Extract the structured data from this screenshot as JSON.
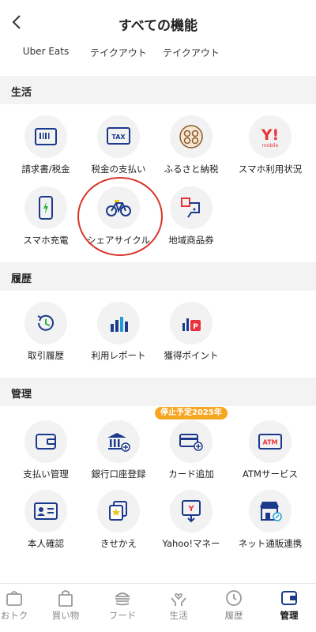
{
  "header": {
    "title": "すべての機能"
  },
  "top_row": [
    "Uber Eats",
    "テイクアウト",
    "テイクアウト"
  ],
  "sections": {
    "life": {
      "title": "生活",
      "items": [
        {
          "label": "請求書/税金",
          "icon": "barcode-icon"
        },
        {
          "label": "税金の支払い",
          "icon": "tax-icon"
        },
        {
          "label": "ふるさと納税",
          "icon": "furusato-icon"
        },
        {
          "label": "スマホ利用状況",
          "icon": "ymobile-icon"
        },
        {
          "label": "スマホ充電",
          "icon": "phone-charge-icon"
        },
        {
          "label": "シェアサイクル",
          "icon": "bicycle-icon"
        },
        {
          "label": "地域商品券",
          "icon": "local-voucher-icon"
        }
      ]
    },
    "history": {
      "title": "履歴",
      "items": [
        {
          "label": "取引履歴",
          "icon": "history-clock-icon"
        },
        {
          "label": "利用レポート",
          "icon": "bar-chart-icon"
        },
        {
          "label": "獲得ポイント",
          "icon": "points-icon"
        }
      ]
    },
    "manage": {
      "title": "管理",
      "badge": "停止予定2025年",
      "items": [
        {
          "label": "支払い管理",
          "icon": "wallet-icon"
        },
        {
          "label": "銀行口座登録",
          "icon": "bank-icon"
        },
        {
          "label": "カード追加",
          "icon": "card-add-icon"
        },
        {
          "label": "ATMサービス",
          "icon": "atm-icon"
        },
        {
          "label": "本人確認",
          "icon": "id-card-icon"
        },
        {
          "label": "きせかえ",
          "icon": "theme-icon"
        },
        {
          "label": "Yahoo!マネー",
          "icon": "yahoo-money-icon"
        },
        {
          "label": "ネット通販連携",
          "icon": "shop-link-icon"
        }
      ]
    }
  },
  "tabs": [
    {
      "label": "おトク",
      "icon": "deal-icon",
      "active": false
    },
    {
      "label": "買い物",
      "icon": "shopping-bag-icon",
      "active": false
    },
    {
      "label": "フード",
      "icon": "burger-icon",
      "active": false
    },
    {
      "label": "生活",
      "icon": "hands-heart-icon",
      "active": false
    },
    {
      "label": "履歴",
      "icon": "clock-icon",
      "active": false
    },
    {
      "label": "管理",
      "icon": "wallet-tab-icon",
      "active": true
    }
  ],
  "colors": {
    "accent_red": "#e8333a",
    "highlight_ring": "#d9342b",
    "badge": "#f5a623",
    "icon_blue": "#1b3a8c"
  }
}
